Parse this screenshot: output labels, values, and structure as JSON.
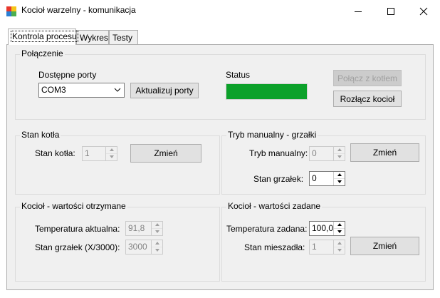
{
  "window": {
    "title": "Kocioł warzelny - komunikacja",
    "minimize_icon": "minimize-icon",
    "maximize_icon": "maximize-icon",
    "close_icon": "close-icon"
  },
  "tabs": [
    {
      "label": "Kontrola procesu",
      "active": true
    },
    {
      "label": "Wykres",
      "active": false
    },
    {
      "label": "Testy",
      "active": false
    }
  ],
  "connection": {
    "title": "Połączenie",
    "ports_label": "Dostępne porty",
    "port_value": "COM3",
    "refresh_button": "Aktualizuj porty",
    "status_label": "Status",
    "status_color": "#0ca12a",
    "connect_button": "Połącz z kotłem",
    "disconnect_button": "Rozłącz kocioł"
  },
  "boiler_state": {
    "title": "Stan kotła",
    "label": "Stan kotła:",
    "value": "1",
    "change_button": "Zmień"
  },
  "manual_mode": {
    "title": "Tryb manualny - grzałki",
    "mode_label": "Tryb manualny:",
    "mode_value": "0",
    "change_button": "Zmień",
    "heaters_label": "Stan grzałek:",
    "heaters_value": "0"
  },
  "received": {
    "title": "Kocioł  - wartości otrzymane",
    "temp_label": "Temperatura aktualna:",
    "temp_value": "91,8",
    "heaters_label": "Stan grzałek (X/3000):",
    "heaters_value": "3000"
  },
  "setpoints": {
    "title": "Kocioł - wartości zadane",
    "temp_label": "Temperatura zadana:",
    "temp_value": "100,0",
    "mixer_label": "Stan mieszadła:",
    "mixer_value": "1",
    "change_button": "Zmień"
  }
}
